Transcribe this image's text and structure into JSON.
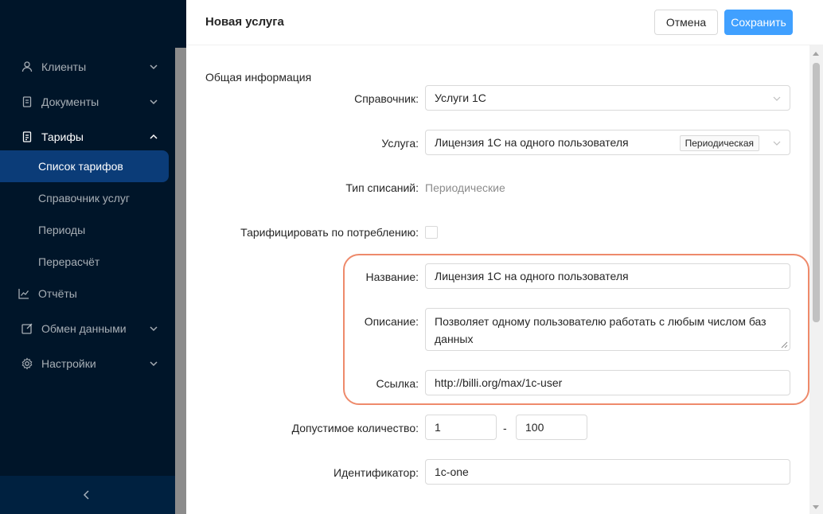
{
  "sidebar": {
    "items": [
      {
        "label": "Клиенты",
        "icon": "user-icon"
      },
      {
        "label": "Документы",
        "icon": "documents-icon"
      },
      {
        "label": "Тарифы",
        "icon": "tariff-icon"
      },
      {
        "label": "Отчёты",
        "icon": "chart-icon"
      },
      {
        "label": "Обмен данными",
        "icon": "edit-icon"
      },
      {
        "label": "Настройки",
        "icon": "gear-icon"
      }
    ],
    "submenu": [
      {
        "label": "Список тарифов"
      },
      {
        "label": "Справочник услуг"
      },
      {
        "label": "Периоды"
      },
      {
        "label": "Перерасчёт"
      }
    ],
    "collapse_icon": "chevron-left-icon"
  },
  "drawer": {
    "title": "Новая услуга",
    "cancel_label": "Отмена",
    "save_label": "Сохранить"
  },
  "form": {
    "section_title": "Общая информация",
    "directory": {
      "label": "Справочник:",
      "value": "Услуги 1С"
    },
    "service": {
      "label": "Услуга:",
      "value": "Лицензия 1С на одного пользователя",
      "tag": "Периодическая"
    },
    "charge_type": {
      "label": "Тип списаний:",
      "value": "Периодические"
    },
    "usage_billing": {
      "label": "Тарифицировать по потреблению:",
      "checked": false
    },
    "name": {
      "label": "Название:",
      "value": "Лицензия 1С на одного пользователя"
    },
    "description": {
      "label": "Описание:",
      "value": "Позволяет одному пользователю работать с любым числом баз данных"
    },
    "link": {
      "label": "Ссылка:",
      "value": "http://billi.org/max/1c-user"
    },
    "quantity": {
      "label": "Допустимое количество:",
      "min": "1",
      "separator": "-",
      "max": "100"
    },
    "identifier": {
      "label": "Идентификатор:",
      "value": "1c-one"
    }
  },
  "colors": {
    "sidebar_bg": "#001529",
    "active_item": "#0b3c78",
    "primary": "#40a0ff",
    "highlight": "#ee8a6b"
  }
}
